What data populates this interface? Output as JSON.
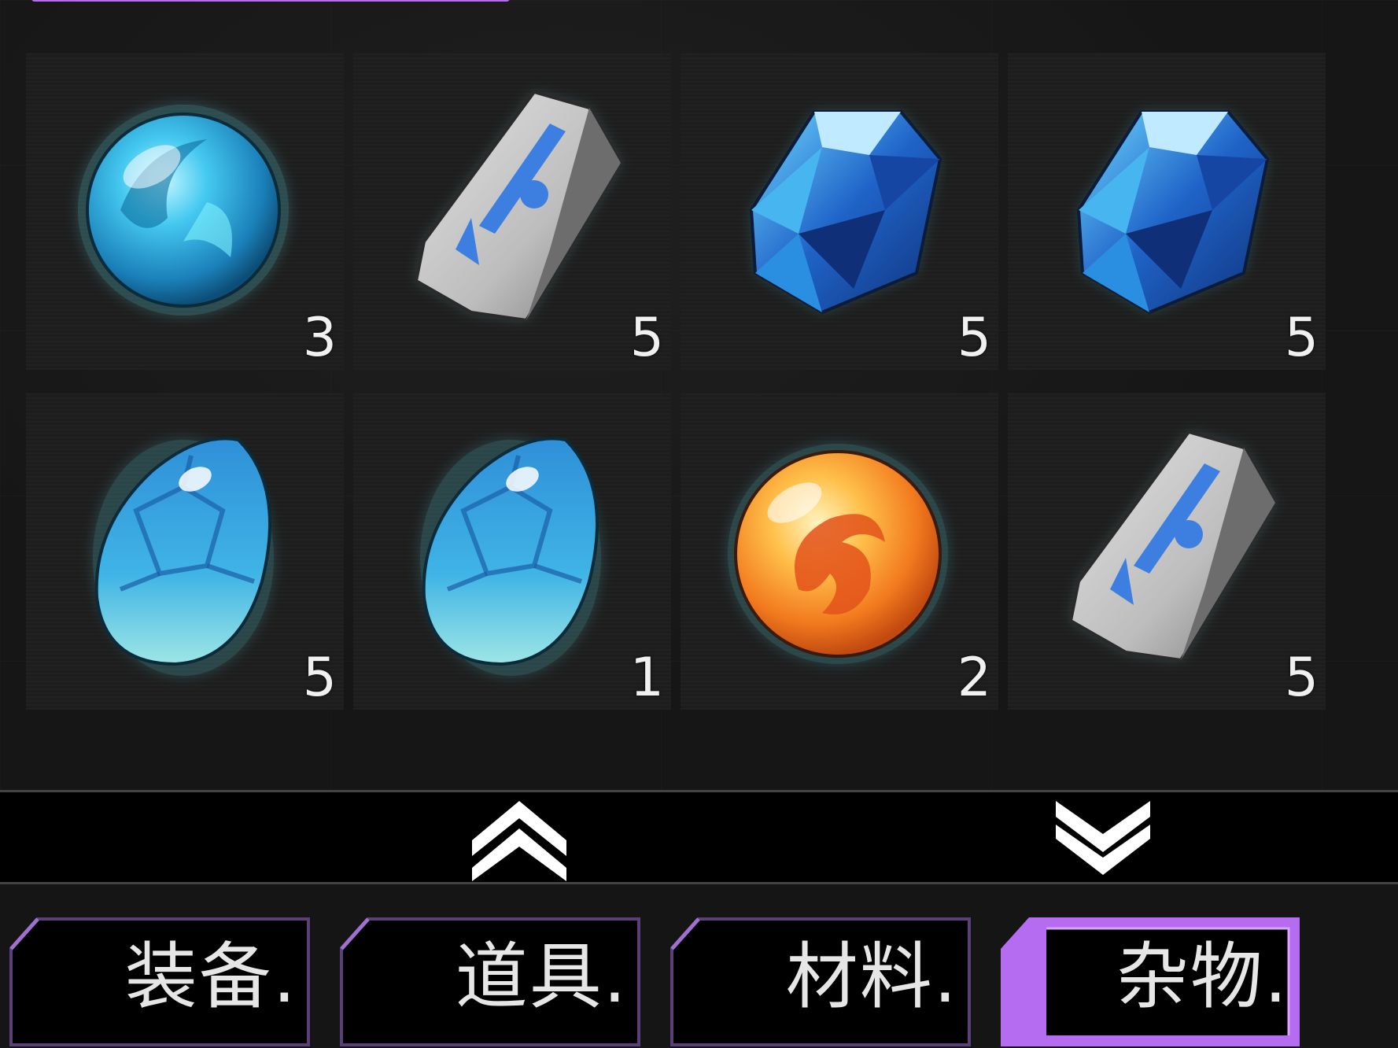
{
  "inventory": {
    "items": [
      {
        "name": "blue-orb",
        "count": "3"
      },
      {
        "name": "rune-stone",
        "count": "5"
      },
      {
        "name": "blue-crystal",
        "count": "5"
      },
      {
        "name": "blue-crystal",
        "count": "5"
      },
      {
        "name": "blue-egg",
        "count": "5"
      },
      {
        "name": "blue-egg",
        "count": "1"
      },
      {
        "name": "fire-orb",
        "count": "2"
      },
      {
        "name": "rune-stone",
        "count": "5"
      }
    ]
  },
  "scroll": {
    "up_icon": "double-chevron-up-icon",
    "down_icon": "double-chevron-down-icon"
  },
  "tabs": [
    {
      "label": "装备.",
      "active": false
    },
    {
      "label": "道具.",
      "active": false
    },
    {
      "label": "材料.",
      "active": false
    },
    {
      "label": "杂物.",
      "active": true
    }
  ],
  "colors": {
    "accent": "#b66cf0",
    "tab_border": "#6a4a8a",
    "background": "#161616"
  }
}
